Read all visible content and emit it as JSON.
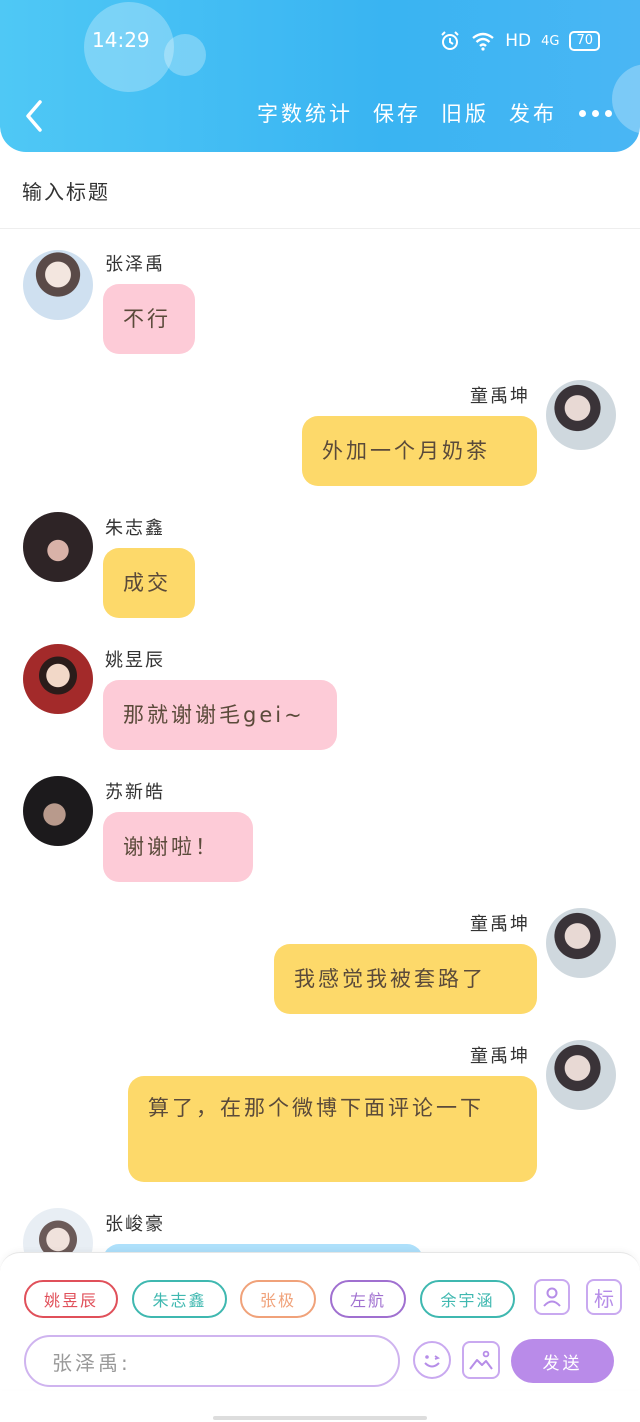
{
  "status_bar": {
    "time": "14:29",
    "network": "HD",
    "signal": "4G",
    "battery": "70"
  },
  "toolbar": {
    "word_count": "字数统计",
    "save": "保存",
    "old_version": "旧版",
    "publish": "发布"
  },
  "title_placeholder": "输入标题",
  "messages": [
    {
      "sender": "张泽禹",
      "text": "不行",
      "side": "left",
      "color": "pink"
    },
    {
      "sender": "童禹坤",
      "text": "外加一个月奶茶",
      "side": "right",
      "color": "yellow"
    },
    {
      "sender": "朱志鑫",
      "text": "成交",
      "side": "left",
      "color": "yellow"
    },
    {
      "sender": "姚昱辰",
      "text": "那就谢谢毛gei~",
      "side": "left",
      "color": "pink"
    },
    {
      "sender": "苏新皓",
      "text": "谢谢啦！",
      "side": "left",
      "color": "pink"
    },
    {
      "sender": "童禹坤",
      "text": "我感觉我被套路了",
      "side": "right",
      "color": "yellow"
    },
    {
      "sender": "童禹坤",
      "text": "算了，在那个微博下面评论一下",
      "side": "right",
      "color": "yellow"
    },
    {
      "sender": "张峻豪",
      "text": "",
      "side": "left",
      "color": "blue"
    }
  ],
  "quick_roles": [
    {
      "name": "姚昱辰",
      "color": "#e0505a"
    },
    {
      "name": "朱志鑫",
      "color": "#3fb8b0"
    },
    {
      "name": "张极",
      "color": "#f0a27a"
    },
    {
      "name": "左航",
      "color": "#a070d0"
    },
    {
      "name": "余宇涵",
      "color": "#3fb8b0"
    }
  ],
  "tools": {
    "role_icon": "person-card-icon",
    "tag_label": "标"
  },
  "composer": {
    "placeholder": "张泽禹:",
    "send_label": "发送"
  },
  "colors": {
    "header": "#3bb6f3",
    "pink_bubble": "#fdcbd7",
    "yellow_bubble": "#fdd96a",
    "blue_bubble": "#aee0fb",
    "accent_purple": "#b98be9"
  }
}
